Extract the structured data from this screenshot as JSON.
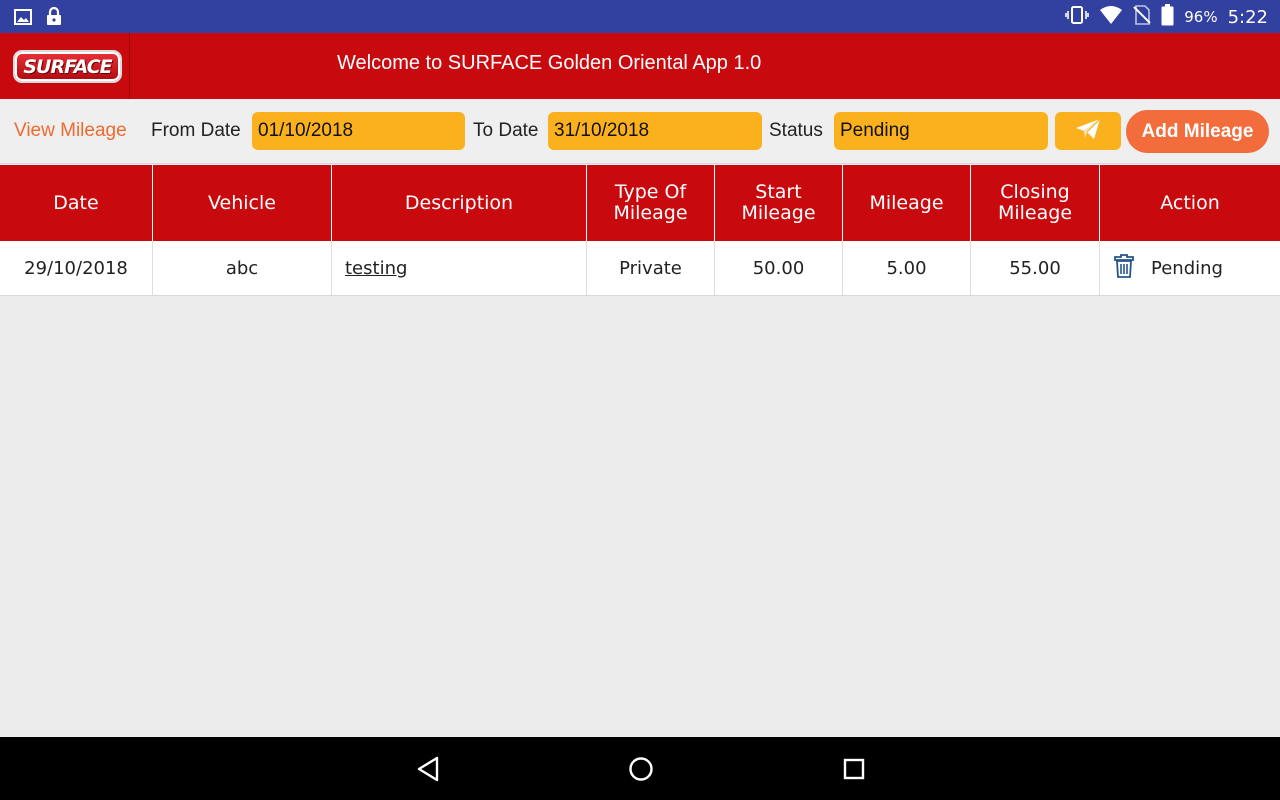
{
  "status_bar": {
    "battery_percent": "96%",
    "time": "5:22",
    "icons": [
      "image-icon",
      "lock-icon",
      "vibrate-icon",
      "wifi-icon",
      "no-sim-icon",
      "battery-icon"
    ]
  },
  "header": {
    "logo_text": "SURFACE",
    "title": "Welcome to SURFACE Golden Oriental App 1.0"
  },
  "filter": {
    "view_title": "View Mileage",
    "from_label": "From Date",
    "from_value": "01/10/2018",
    "to_label": "To Date",
    "to_value": "31/10/2018",
    "status_label": "Status",
    "status_value": "Pending",
    "add_button": "Add Mileage"
  },
  "table": {
    "headers": [
      "Date",
      "Vehicle",
      "Description",
      "Type Of Mileage",
      "Start Mileage",
      "Mileage",
      "Closing Mileage",
      "Action"
    ],
    "rows": [
      {
        "date": "29/10/2018",
        "vehicle": "abc",
        "description": "testing",
        "type": "Private",
        "start": "50.00",
        "mileage": "5.00",
        "closing": "55.00",
        "status": "Pending"
      }
    ]
  },
  "colors": {
    "brand_red": "#c80a0f",
    "field_yellow": "#fbb11e",
    "accent_orange": "#f26c3c",
    "status_bar": "#3240a0"
  }
}
